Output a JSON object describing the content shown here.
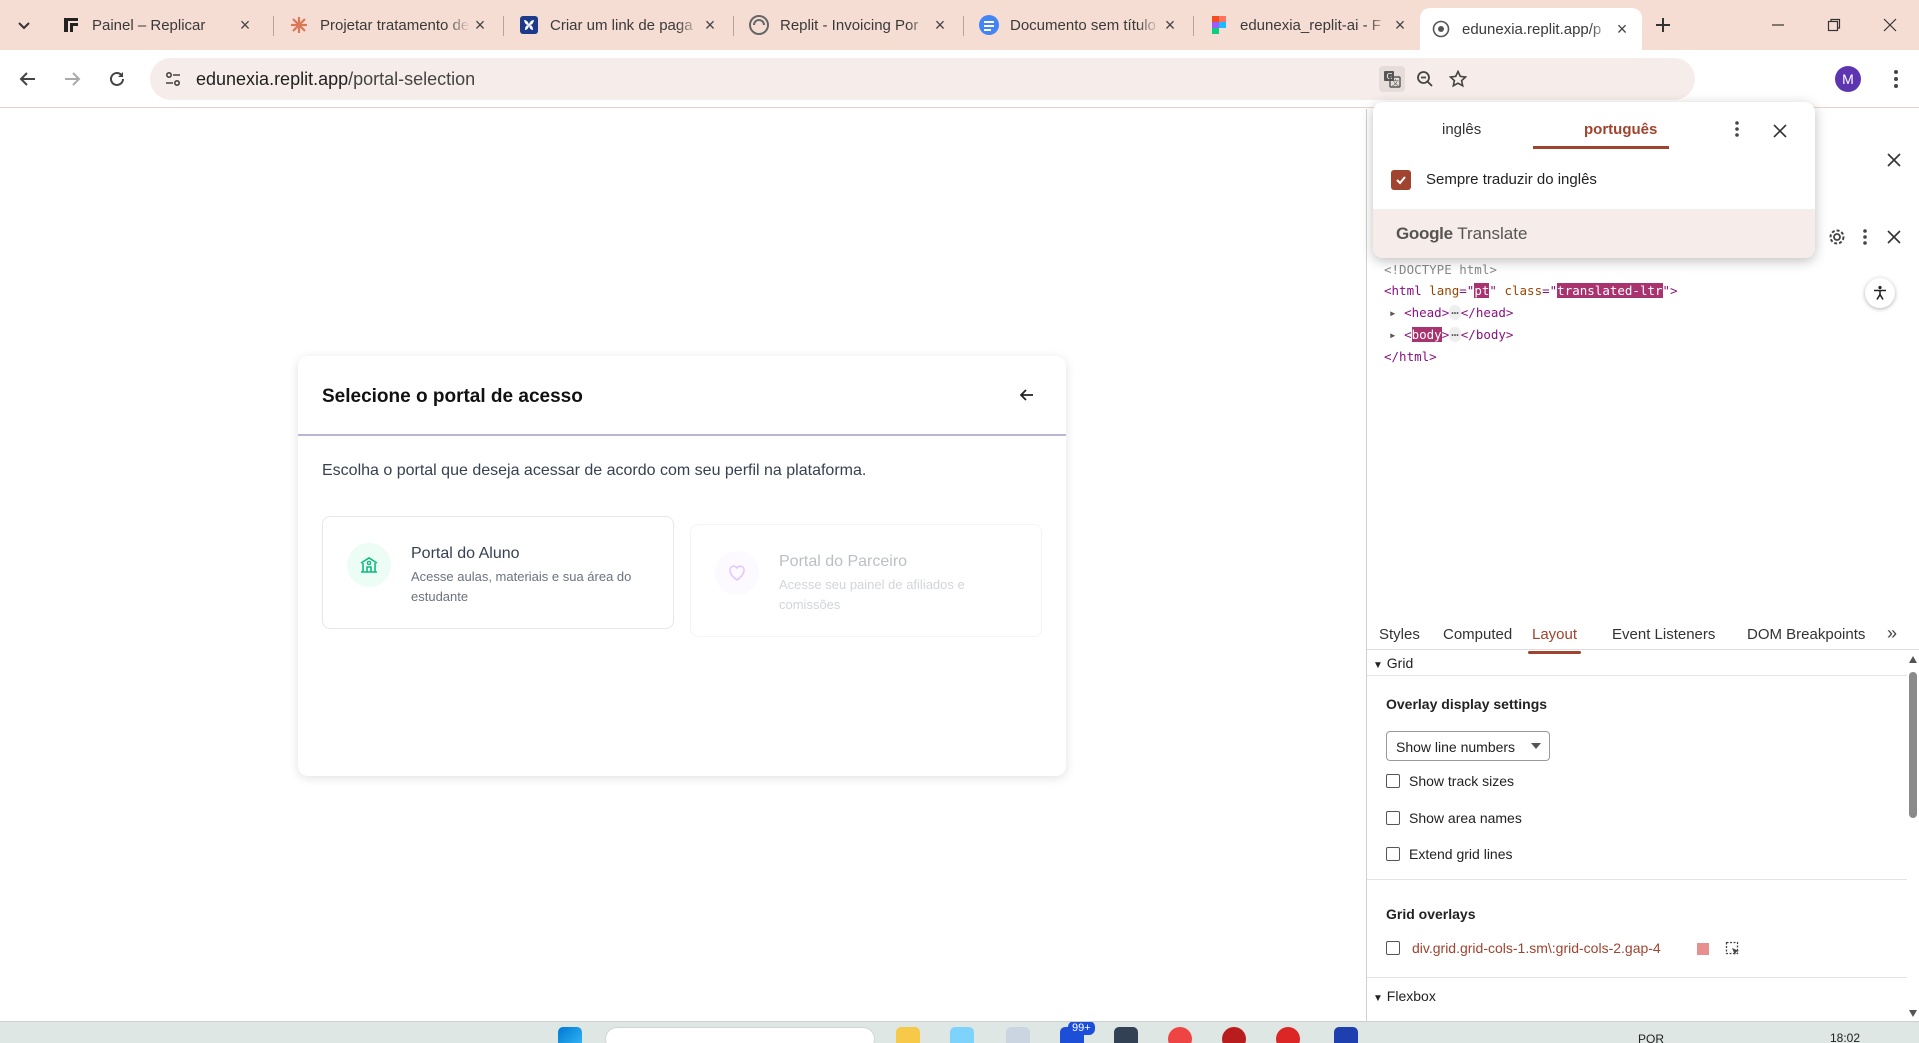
{
  "tabs": [
    {
      "title": "Painel – Replicar",
      "icon": "replicar-logo-icon"
    },
    {
      "title": "Projetar tratamento de",
      "icon": "claude-logo-icon"
    },
    {
      "title": "Criar um link de paga",
      "icon": "butterfly-logo-icon"
    },
    {
      "title": "Replit - Invoicing Por",
      "icon": "replit-logo-icon"
    },
    {
      "title": "Documento sem título",
      "icon": "docs-logo-icon"
    },
    {
      "title": "edunexia_replit-ai - F",
      "icon": "figma-logo-icon"
    },
    {
      "title": "edunexia.replit.app/p",
      "icon": "globe-icon"
    }
  ],
  "address": {
    "host": "edunexia.replit.app",
    "path": "/portal-selection"
  },
  "profile_initial": "M",
  "page": {
    "title": "Selecione o portal de acesso",
    "description": "Escolha o portal que deseja acessar de acordo com seu perfil na plataforma.",
    "portals": [
      {
        "title": "Portal do Aluno",
        "description": "Acesse aulas, materiais e sua área do estudante",
        "icon": "school-icon",
        "color": "#10b981"
      },
      {
        "title": "Portal do Parceiro",
        "description": "Acesse seu painel de afiliados e comissões",
        "icon": "heart-icon",
        "color": "#c084fc"
      }
    ]
  },
  "translate": {
    "lang_from": "inglês",
    "lang_to": "português",
    "always_label": "Sempre traduzir do inglês",
    "brand_google": "Google",
    "brand_translate": "Translate"
  },
  "devtools": {
    "doctype": "<!DOCTYPE html>",
    "html_open_tag": "<html",
    "lang_attr": "lang",
    "lang_val": "pt",
    "class_attr": "class",
    "class_val": "translated-ltr",
    "head_tag": "head",
    "body_tag": "body",
    "html_close": "</html>",
    "panel_tabs": [
      "Styles",
      "Computed",
      "Layout",
      "Event Listeners",
      "DOM Breakpoints"
    ],
    "grid_section": "Grid",
    "overlay_heading": "Overlay display settings",
    "line_select": "Show line numbers",
    "options": [
      "Show track sizes",
      "Show area names",
      "Extend grid lines"
    ],
    "overlays_heading": "Grid overlays",
    "overlay_item": "div.grid.grid-cols-1.sm\\:grid-cols-2.gap-4",
    "overlay_color": "#e8908f",
    "flex_section": "Flexbox"
  },
  "taskbar": {
    "badge": "99+",
    "lang": "POR",
    "time": "18:02"
  }
}
